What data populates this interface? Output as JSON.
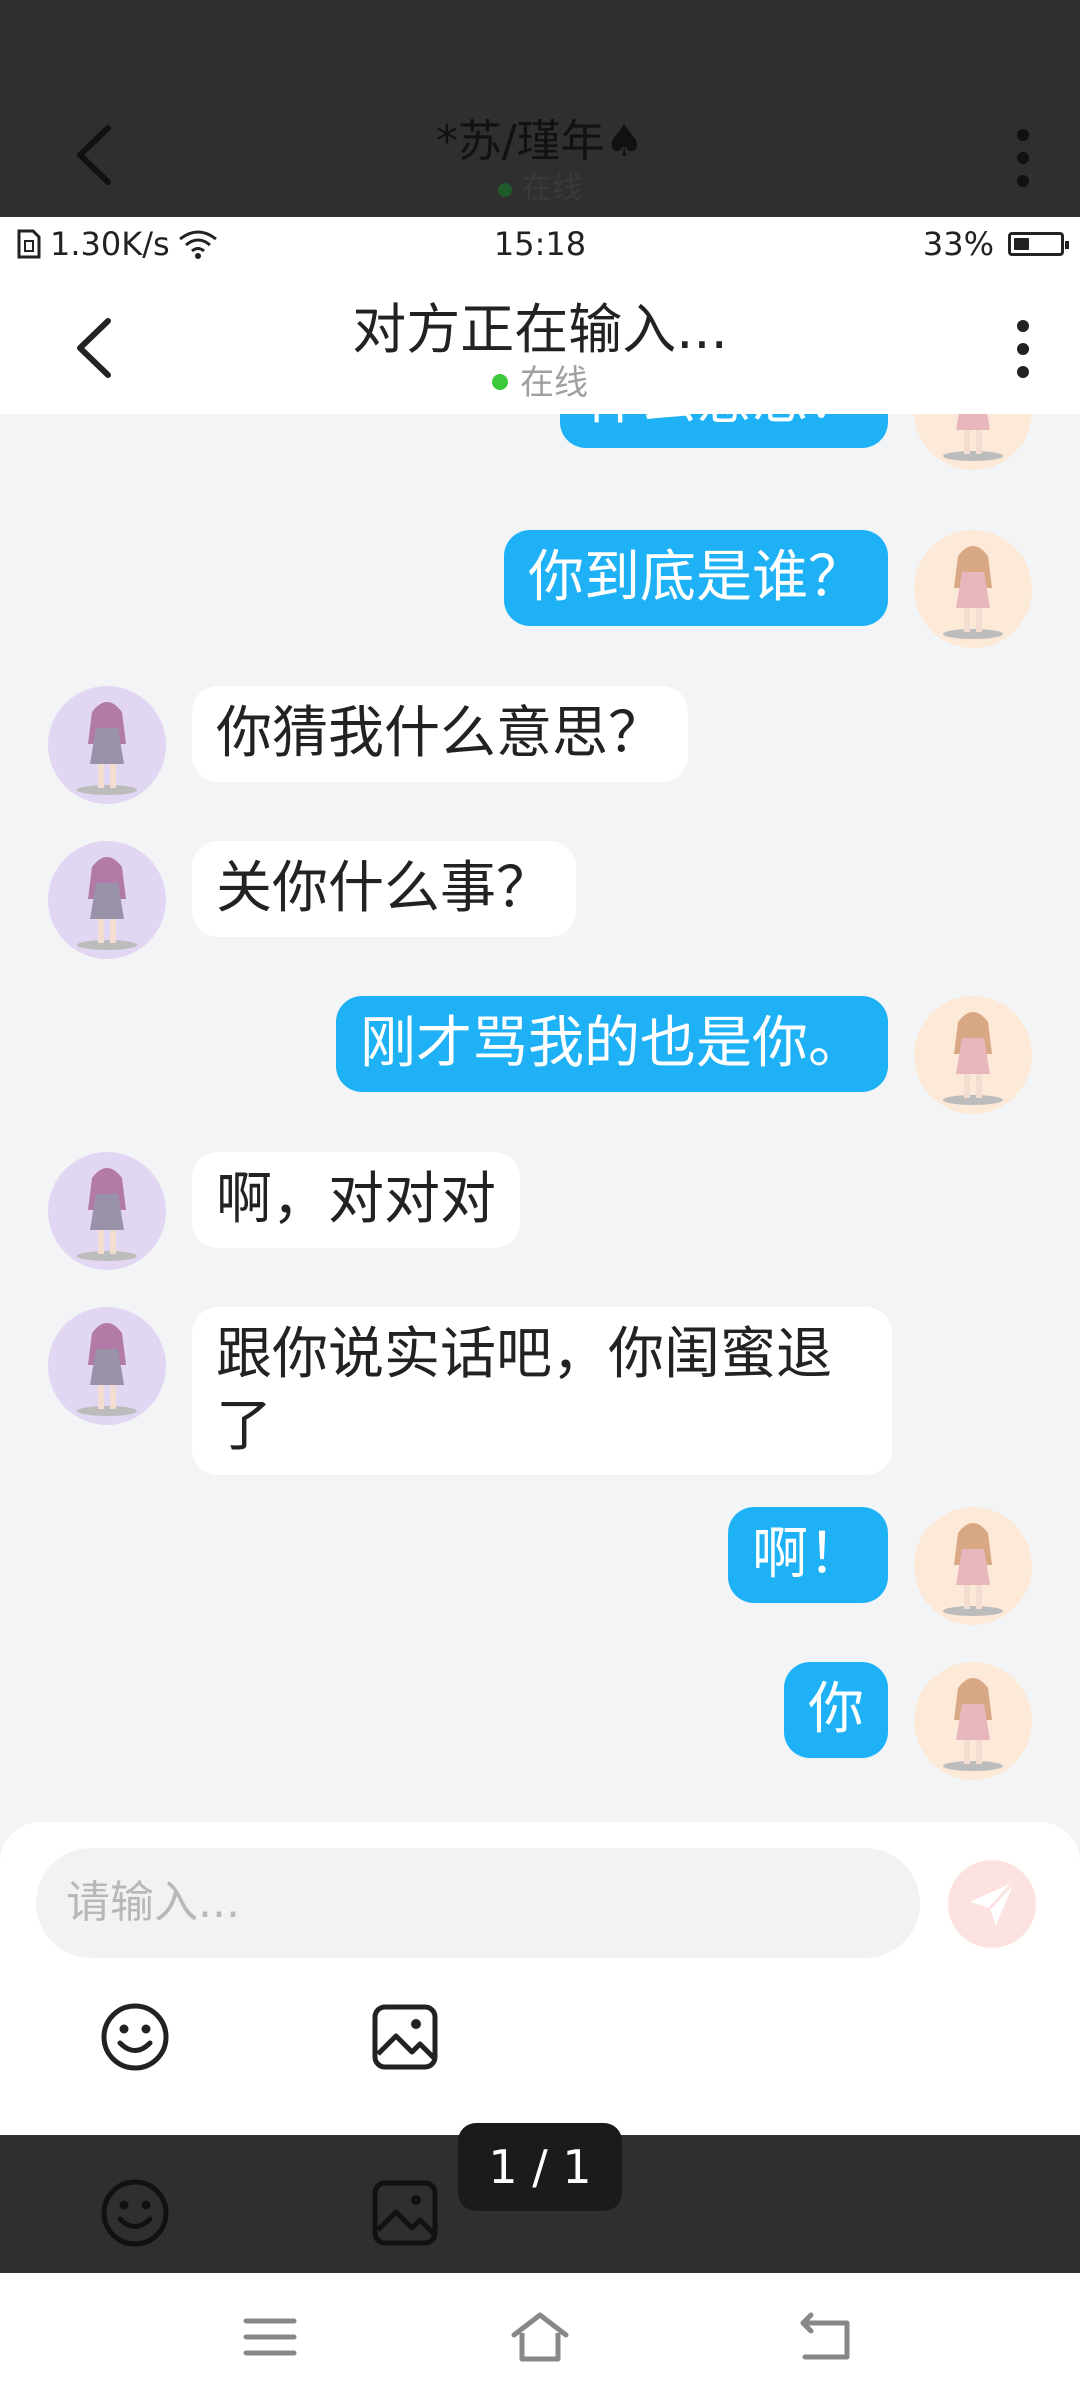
{
  "overlay": {
    "title": "*苏/瑾年♠",
    "status": "在线",
    "pager": "1 / 1"
  },
  "statusbar": {
    "speed": "1.30K/s",
    "time": "15:18",
    "battery": "33%",
    "battery_level": 0.33
  },
  "header": {
    "title": "对方正在输入...",
    "status": "在线",
    "online_color": "#3cc93c"
  },
  "colors": {
    "my_bubble": "#1fb1f5",
    "other_bubble": "#ffffff",
    "chat_bg": "#f3f4f6"
  },
  "messages": [
    {
      "from": "me",
      "text": "什么意思？"
    },
    {
      "from": "me",
      "text": "你到底是谁？"
    },
    {
      "from": "other",
      "text": "你猜我什么意思？"
    },
    {
      "from": "other",
      "text": "关你什么事？"
    },
    {
      "from": "me",
      "text": "刚才骂我的也是你。"
    },
    {
      "from": "other",
      "text": "啊，对对对"
    },
    {
      "from": "other",
      "text": "跟你说实话吧，你闺蜜退了"
    },
    {
      "from": "me",
      "text": "啊！"
    },
    {
      "from": "me",
      "text": "你"
    }
  ],
  "composer": {
    "placeholder": "请输入...",
    "icons": [
      "emoji-icon",
      "image-icon",
      "send-icon"
    ]
  },
  "navbar": {
    "icons": [
      "menu-icon",
      "home-icon",
      "back-icon"
    ]
  }
}
